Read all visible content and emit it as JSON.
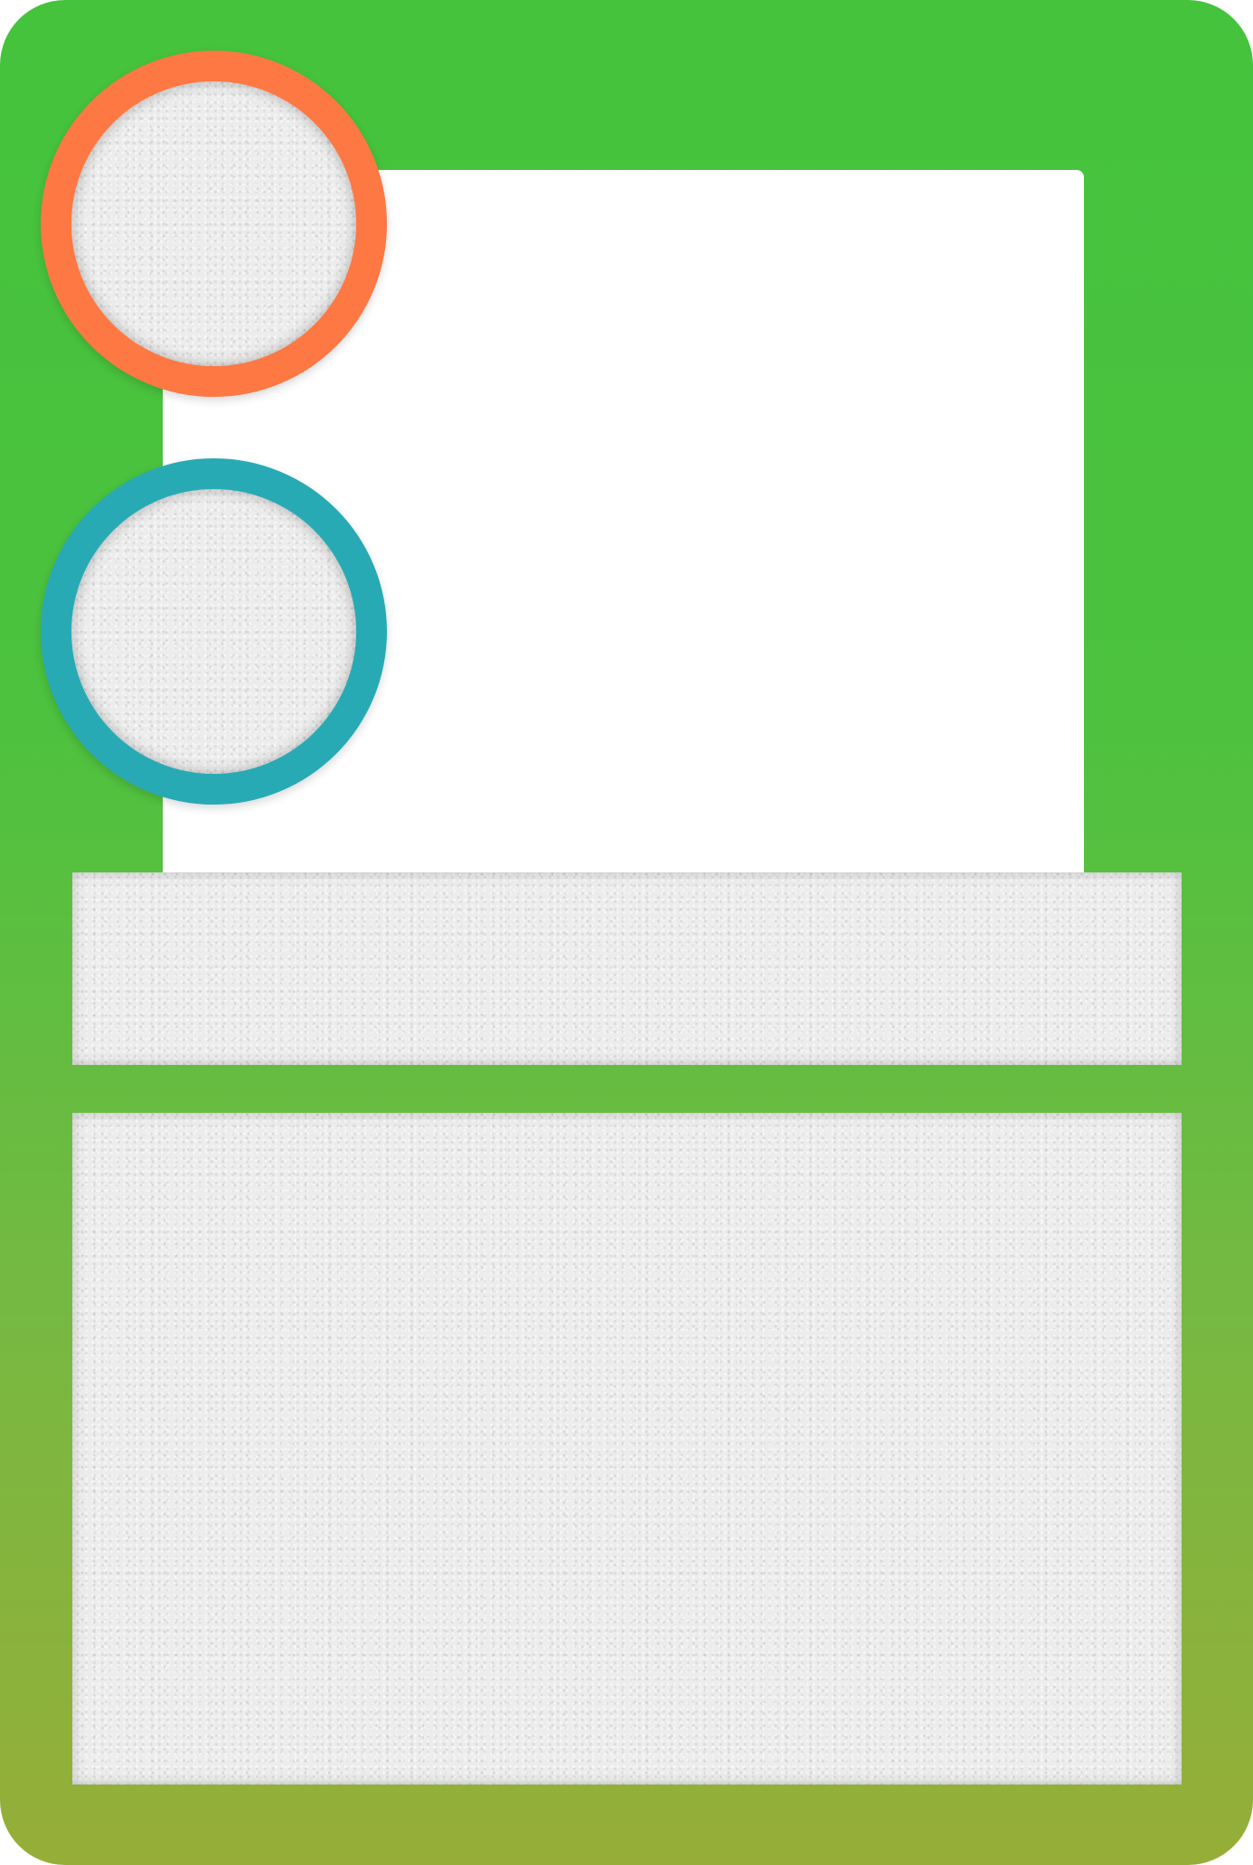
{
  "card": {
    "frame_color_top": "#45c33d",
    "frame_color_bottom": "#96ae38",
    "badges": [
      {
        "name": "orange-badge",
        "ring_color": "#fd7843"
      },
      {
        "name": "teal-badge",
        "ring_color": "#28aab5"
      }
    ],
    "panel_texture": "light-grey-speckled"
  }
}
